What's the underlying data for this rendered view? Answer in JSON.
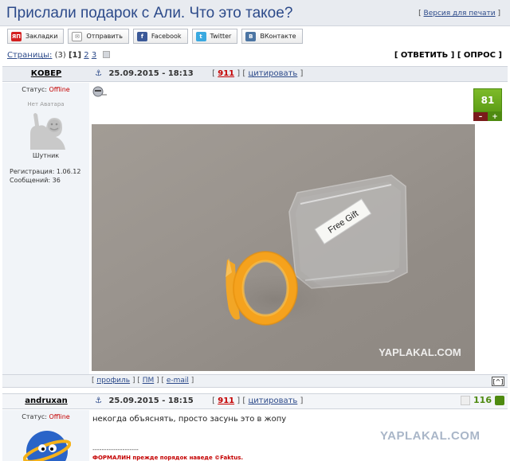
{
  "title": "Прислали подарок с Али. Что это такое?",
  "print_link": "Версия для печати",
  "share": [
    {
      "label": "Закладки",
      "icon": "ya-icon",
      "glyph": "ЯП",
      "color": "#d42020"
    },
    {
      "label": "Отправить",
      "icon": "mail-icon",
      "glyph": "✉",
      "color": "#888888"
    },
    {
      "label": "Facebook",
      "icon": "facebook-icon",
      "glyph": "f",
      "color": "#3b5998"
    },
    {
      "label": "Twitter",
      "icon": "twitter-icon",
      "glyph": "t",
      "color": "#3aa9e0"
    },
    {
      "label": "ВКонтакте",
      "icon": "vk-icon",
      "glyph": "В",
      "color": "#4c75a3"
    }
  ],
  "pages": {
    "label": "Страницы:",
    "count": "(3)",
    "current": "[1]",
    "p2": "2",
    "p3": "3"
  },
  "actions": {
    "reply": "[ ОТВЕТИТЬ ]",
    "poll": "[ ОПРОС ]"
  },
  "post1": {
    "author": "КОВЕР",
    "anchor": "⚓",
    "date": "25.09.2015 - 18:13",
    "number": "911",
    "quote": "цитировать",
    "status_label": "Статус:",
    "status_value": "Offline",
    "no_avatar": "Нет Аватара",
    "rank": "Шутник",
    "reg_label": "Регистрация:",
    "reg_value": "1.06.12",
    "msgs_label": "Сообщений:",
    "msgs_value": "36",
    "rating": "81",
    "minus": "–",
    "plus": "+",
    "photo_label": "Free Gift",
    "watermark": "YAPLAKAL.COM"
  },
  "foot": {
    "profile": "профиль",
    "pm": "ПМ",
    "email": "e-mail",
    "up": "[^]"
  },
  "post2": {
    "author": "andruxan",
    "anchor": "⚓",
    "date": "25.09.2015 - 18:15",
    "number": "911",
    "quote": "цитировать",
    "status_label": "Статус:",
    "status_value": "Offline",
    "rating": "116",
    "text": "некогда объяснять, просто засунь это в жопу",
    "sig_line": "--------------------",
    "sig": "ФОРМАЛИН прежде порядок наведе ©Faktus.",
    "watermark": "YAPLAKAL.COM"
  }
}
